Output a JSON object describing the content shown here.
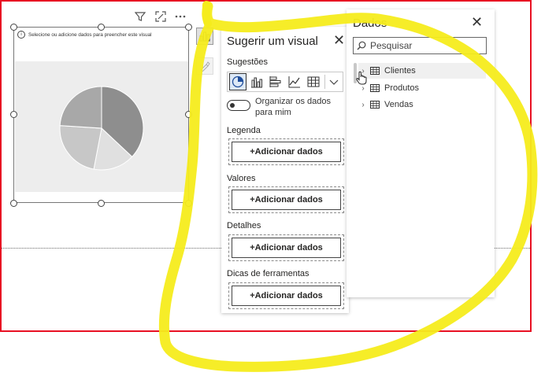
{
  "visual": {
    "placeholder_message": "Selecione ou adicione dados para preencher este visual",
    "header_icons": [
      "filter-icon",
      "focus-mode-icon",
      "more-options-icon"
    ],
    "pie_slices": [
      0.37,
      0.16,
      0.23,
      0.24
    ],
    "pie_colors": [
      "#8e8e8e",
      "#e0e0e0",
      "#c7c7c7",
      "#a8a8a8"
    ]
  },
  "build_pane": {
    "title": "Sugerir um visual",
    "close_icon": "close-icon",
    "suggestions_label": "Sugestões",
    "suggestion_icons": [
      "pie-chart-icon",
      "clustered-column-icon",
      "stacked-bar-icon",
      "line-chart-icon",
      "table-icon"
    ],
    "toggle_label": "Organizar os dados para mim",
    "toggle_on": false,
    "wells": [
      {
        "label": "Legenda",
        "button": "+Adicionar dados"
      },
      {
        "label": "Valores",
        "button": "+Adicionar dados"
      },
      {
        "label": "Detalhes",
        "button": "+Adicionar dados"
      },
      {
        "label": "Dicas de ferramentas",
        "button": "+Adicionar dados"
      }
    ]
  },
  "data_pane": {
    "title": "Dados",
    "search_placeholder": "Pesquisar",
    "tables": [
      {
        "name": "Clientes",
        "icon": "table-icon",
        "hovered": true
      },
      {
        "name": "Produtos",
        "icon": "table-icon"
      },
      {
        "name": "Vendas",
        "icon": "table-icon"
      }
    ]
  },
  "colors": {
    "annotation_red": "#e81123",
    "annotation_yellow": "#f5ec1c",
    "build_button_active": "#e0e0e0"
  }
}
